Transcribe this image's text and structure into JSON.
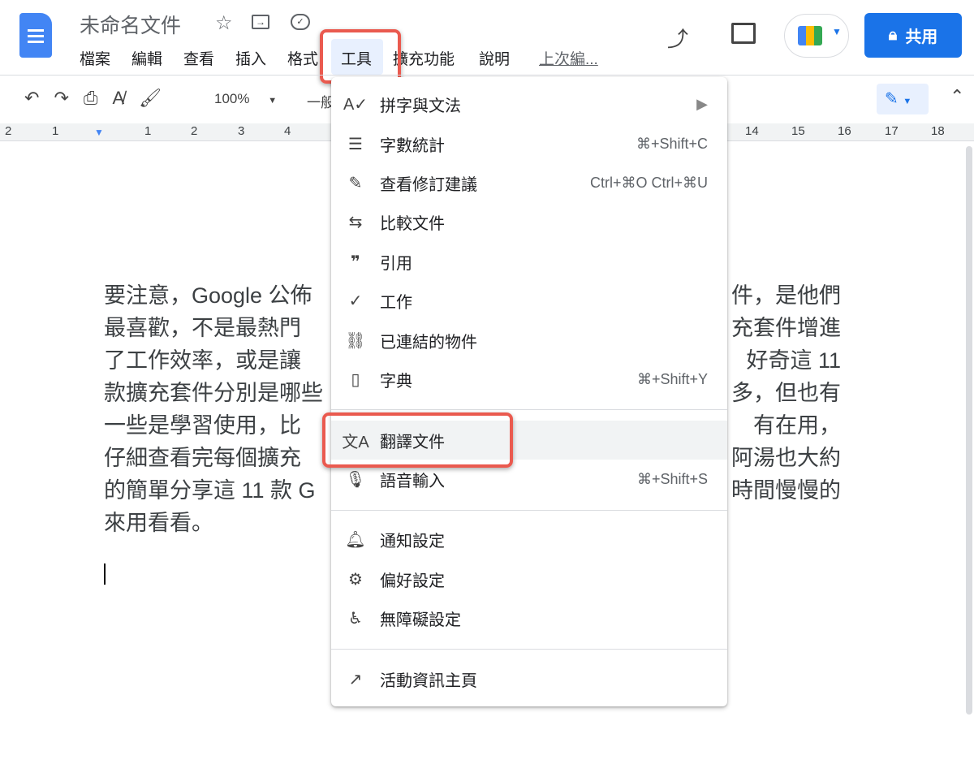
{
  "doc_title": "未命名文件",
  "menubar": [
    "檔案",
    "編輯",
    "查看",
    "插入",
    "格式",
    "工具",
    "擴充功能",
    "說明"
  ],
  "last_edit": "上次編...",
  "share_label": "共用",
  "toolbar": {
    "zoom": "100%",
    "style": "一般"
  },
  "ruler": [
    "2",
    "1",
    "1",
    "2",
    "3",
    "4",
    "14",
    "15",
    "16",
    "17",
    "18"
  ],
  "paragraph": [
    {
      "left": "要注意，Google 公佈",
      "right": "件，是他們"
    },
    {
      "left": "最喜歡，不是最熱門",
      "right": "充套件增進"
    },
    {
      "left": "了工作效率，或是讓",
      "right": "好奇這 11"
    },
    {
      "left": "款擴充套件分別是哪些",
      "right": "多，但也有"
    },
    {
      "left": "一些是學習使用，比",
      "right": "有在用，"
    },
    {
      "left": "仔細查看完每個擴充",
      "right": "阿湯也大約"
    },
    {
      "left": "的簡單分享這 11 款 G",
      "right": "時間慢慢的"
    },
    {
      "left": "來用看看。",
      "right": ""
    }
  ],
  "tools_menu": [
    {
      "label": "拼字與文法",
      "shortcut": "▶",
      "icon": "spellcheck-icon"
    },
    {
      "label": "字數統計",
      "shortcut": "⌘+Shift+C",
      "icon": "word-count-icon"
    },
    {
      "label": "查看修訂建議",
      "shortcut": "Ctrl+⌘O Ctrl+⌘U",
      "icon": "review-edits-icon"
    },
    {
      "label": "比較文件",
      "shortcut": "",
      "icon": "compare-icon"
    },
    {
      "label": "引用",
      "shortcut": "",
      "icon": "quote-icon"
    },
    {
      "label": "工作",
      "shortcut": "",
      "icon": "task-check-icon"
    },
    {
      "label": "已連結的物件",
      "shortcut": "",
      "icon": "linked-objects-icon"
    },
    {
      "label": "字典",
      "shortcut": "⌘+Shift+Y",
      "icon": "dictionary-icon"
    },
    {
      "label": "翻譯文件",
      "shortcut": "",
      "icon": "translate-icon"
    },
    {
      "label": "語音輸入",
      "shortcut": "⌘+Shift+S",
      "icon": "microphone-icon"
    },
    {
      "label": "通知設定",
      "shortcut": "",
      "icon": "bell-icon"
    },
    {
      "label": "偏好設定",
      "shortcut": "",
      "icon": "preferences-icon"
    },
    {
      "label": "無障礙設定",
      "shortcut": "",
      "icon": "accessibility-icon"
    },
    {
      "label": "活動資訊主頁",
      "shortcut": "",
      "icon": "activity-icon"
    }
  ]
}
